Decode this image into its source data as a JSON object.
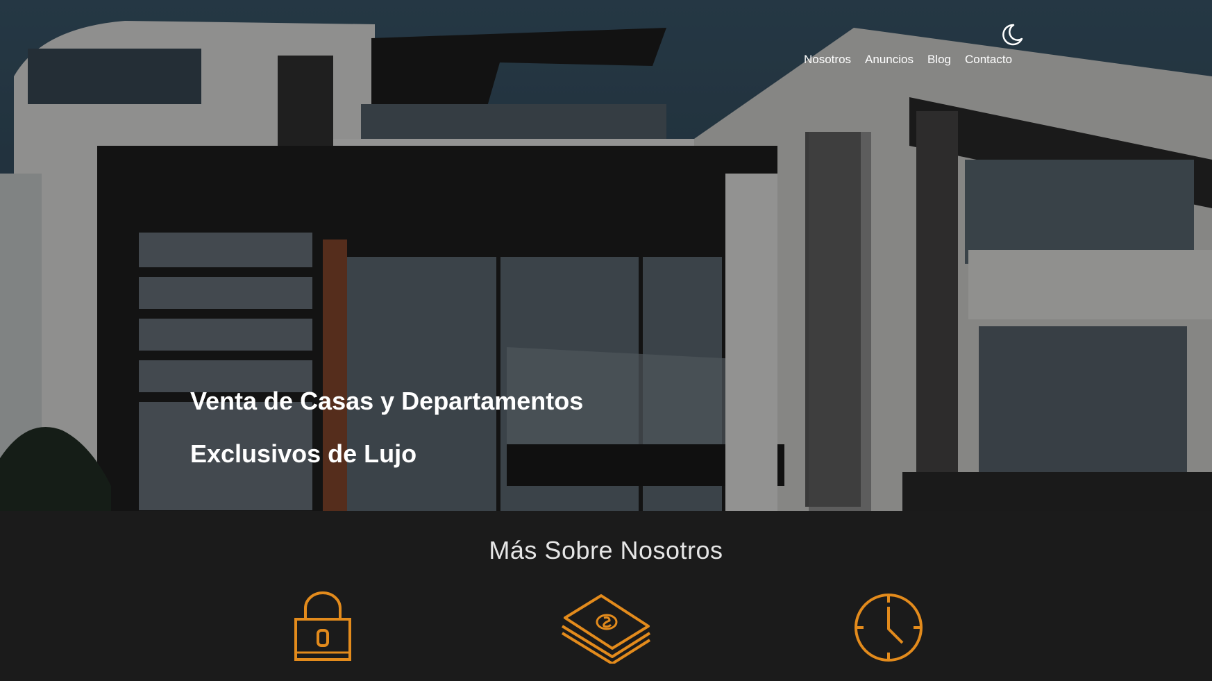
{
  "nav": {
    "theme_icon": "moon-icon",
    "links": [
      "Nosotros",
      "Anuncios",
      "Blog",
      "Contacto"
    ]
  },
  "hero": {
    "line1": "Venta de Casas y Departamentos",
    "line2": "Exclusivos de Lujo"
  },
  "about": {
    "title": "Más Sobre Nosotros",
    "icons": [
      "lock-icon",
      "money-stack-icon",
      "clock-icon"
    ]
  },
  "colors": {
    "accent": "#e38b1c",
    "text": "#ffffff",
    "section_bg": "#1b1b1b"
  }
}
